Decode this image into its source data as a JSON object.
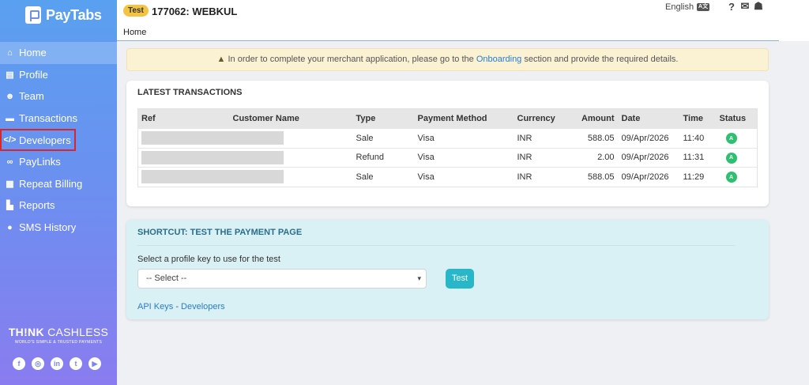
{
  "brand": {
    "name": "PayTabs",
    "tagline_bold": "TH!NK",
    "tagline_thin": "CASHLESS",
    "tagline_sub": "WORLD'S SIMPLE & TRUSTED PAYMENTS"
  },
  "sidebar": {
    "items": [
      {
        "label": "Home",
        "icon": "home-icon"
      },
      {
        "label": "Profile",
        "icon": "profile-icon"
      },
      {
        "label": "Team",
        "icon": "team-icon"
      },
      {
        "label": "Transactions",
        "icon": "transactions-icon"
      },
      {
        "label": "Developers",
        "icon": "code-icon"
      },
      {
        "label": "PayLinks",
        "icon": "link-icon"
      },
      {
        "label": "Repeat Billing",
        "icon": "calendar-icon"
      },
      {
        "label": "Reports",
        "icon": "chart-icon"
      },
      {
        "label": "SMS History",
        "icon": "chat-icon"
      }
    ],
    "socials": [
      "f",
      "◎",
      "in",
      "t",
      "▶"
    ]
  },
  "header": {
    "badge": "Test",
    "merchant": "177062: WEBKUL",
    "language": "English",
    "breadcrumb": "Home"
  },
  "alert": {
    "text_before": "In order to complete your merchant application, please go to the",
    "link": "Onboarding",
    "text_after": "section and provide the required details."
  },
  "transactions": {
    "title": "LATEST TRANSACTIONS",
    "columns": [
      "Ref",
      "Customer Name",
      "Type",
      "Payment Method",
      "Currency",
      "Amount",
      "Date",
      "Time",
      "Status"
    ],
    "rows": [
      {
        "type": "Sale",
        "method": "Visa",
        "currency": "INR",
        "amount": "588.05",
        "date": "09/Apr/2026",
        "time": "11:40",
        "status": "A"
      },
      {
        "type": "Refund",
        "method": "Visa",
        "currency": "INR",
        "amount": "2.00",
        "date": "09/Apr/2026",
        "time": "11:31",
        "status": "A"
      },
      {
        "type": "Sale",
        "method": "Visa",
        "currency": "INR",
        "amount": "588.05",
        "date": "09/Apr/2026",
        "time": "11:29",
        "status": "A"
      }
    ]
  },
  "shortcut": {
    "title": "SHORTCUT: TEST THE PAYMENT PAGE",
    "label": "Select a profile key to use for the test",
    "select_value": "-- Select --",
    "button": "Test",
    "link1": "API Keys",
    "separator": "-",
    "link2": "Developers"
  }
}
